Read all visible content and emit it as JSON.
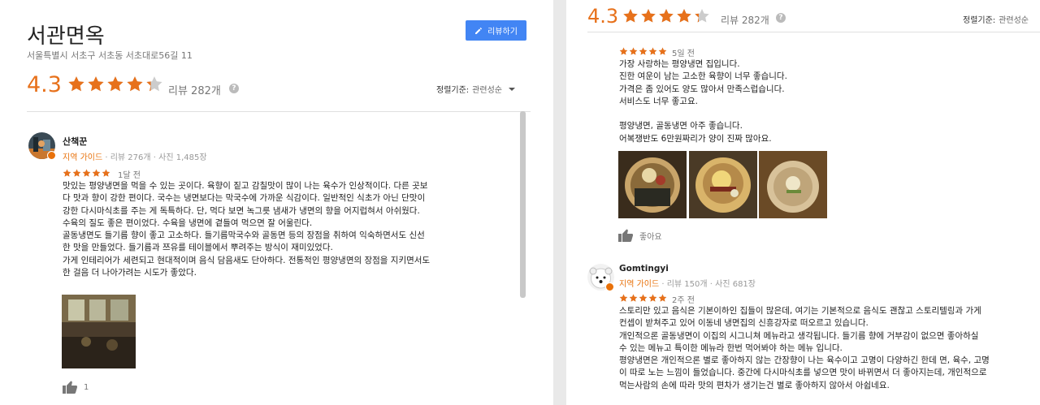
{
  "business": {
    "name": "서관면옥",
    "address": "서울특별시 서초구 서초동 서초대로56길 11",
    "review_button": "리뷰하기",
    "rating": "4.3",
    "stars": 4.3,
    "review_count": "리뷰 282개",
    "sort_label": "정렬기준:",
    "sort_value": "관련성순"
  },
  "reviews_left": [
    {
      "author": "산책꾼",
      "guide": "지역 가이드",
      "stats": " · 리뷰 276개 · 사진 1,485장",
      "stars": 5,
      "time": "1달 전",
      "text": "맛있는 평양냉면을 먹을 수 있는 곳이다. 육향이 짙고 감칠맛이 많이 나는 육수가 인상적이다. 다른 곳보\n다 맛과 향이 강한 편이다. 국수는 냉면보다는 막국수에 가까운 식감이다. 일반적인 식초가 아닌 단맛이\n강한 다시마식초를 주는 게 독특하다. 단, 먹다 보면 녹그릇 냄새가 냉면의 향을 어지럽혀서 아쉬웠다.\n수육의 질도 좋은 편이었다. 수육을 냉면에 곁들여 먹으면 잘 어울린다.\n골동냉면도 들기름 향이 좋고 고소하다. 들기름막국수와 골동면 등의 장점을 취하여 익숙하면서도 신선\n한 맛을 만들었다. 들기름과 쯔유를 테이블에서 뿌려주는 방식이 재미있었다.\n가게 인테리어가 세련되고 현대적이며 음식 담음새도 단아하다. 전통적인 평양냉면의 장점을 지키면서도\n한 걸음 더 나아가려는 시도가 좋았다.",
      "likes": "1"
    }
  ],
  "reviews_right": [
    {
      "stars": 5,
      "time": "5일 전",
      "text": "가장 사랑하는 평양냉면 집입니다.\n진한 여운이 남는 고소한 육향이 너무 좋습니다.\n가격은 좀 있어도 양도 많아서 만족스럽습니다.\n서비스도 너무 좋고요.\n\n평양냉면, 골동냉면 아주 좋습니다.\n어복쟁반도 6만원짜리가 양이 진짜 많아요.",
      "likes": "좋아요"
    },
    {
      "author": "Gomtingyi",
      "guide": "지역 가이드",
      "stats": " · 리뷰 150개 · 사진 681장",
      "stars": 5,
      "time": "2주 전",
      "text": "스토리만 있고 음식은 기본이하인 집들이 많은데, 여기는 기본적으로 음식도 괜찮고 스토리텔링과 가게\n컨셉이 받쳐주고 있어 이동네 냉면집의 신흥강자로 떠오르고 있습니다.\n개인적으론 골동냉면이 이집의 시그니쳐 메뉴라고 생각됩니다. 들기름 향에 거부감이 없으면 좋아하실\n수 있는 메뉴고 특이한 메뉴라 한번 먹어봐야 하는 메뉴 입니다.\n평양냉면은 개인적으론 별로 좋아하지 않는 간장향이 나는 육수이고 고명이 다양하긴 한데 면, 육수, 고명\n이 따로 노는 느낌이 들었습니다. 중간에 다시마식초를 넣으면 맛이 바뀌면서 더 좋아지는데, 개인적으로\n먹는사람의 손에 따라 맛의 편차가 생기는건 별로 좋아하지 않아서 아쉽네요."
    }
  ],
  "colors": {
    "accent": "#e7711b",
    "button": "#4285f4",
    "guide": "#e8710a"
  }
}
